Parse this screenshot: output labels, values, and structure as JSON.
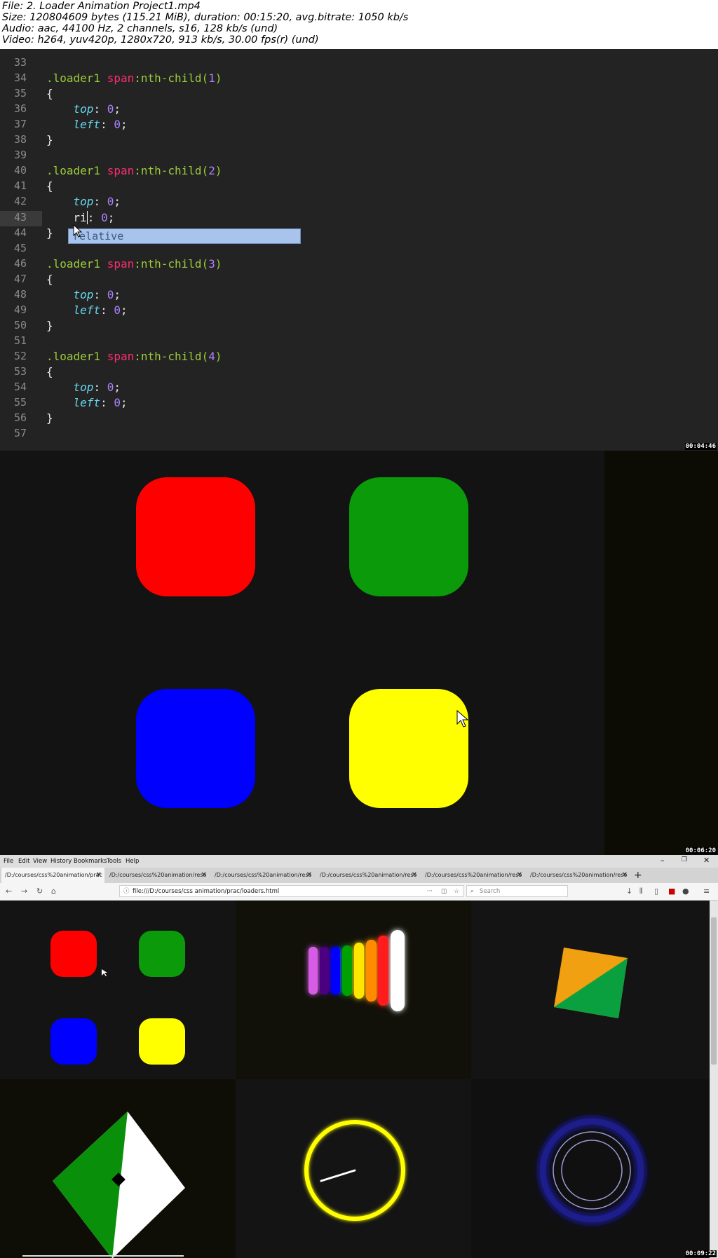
{
  "info": {
    "file": "File: 2. Loader Animation Project1.mp4",
    "size": "Size: 120804609 bytes (115.21 MiB), duration: 00:15:20, avg.bitrate: 1050 kb/s",
    "audio": "Audio: aac, 44100 Hz, 2 channels, s16, 128 kb/s (und)",
    "video": "Video: h264, yuv420p, 1280x720, 913 kb/s, 30.00 fps(r) (und)"
  },
  "timestamps": [
    "00:04:46",
    "00:06:20",
    "00:09:22"
  ],
  "editor": {
    "lines": [
      {
        "n": "33"
      },
      {
        "n": "34",
        "sel": ".loader1 ",
        "tag": "span",
        "sel2": ":nth-child(",
        "num": "1",
        "end": ")"
      },
      {
        "n": "35",
        "text": "{"
      },
      {
        "n": "36",
        "prop": "top",
        "num": "0"
      },
      {
        "n": "37",
        "prop": "left",
        "num": "0"
      },
      {
        "n": "38",
        "text": "}"
      },
      {
        "n": "39"
      },
      {
        "n": "40",
        "sel": ".loader1 ",
        "tag": "span",
        "sel2": ":nth-child(",
        "num": "2",
        "end": ")"
      },
      {
        "n": "41",
        "text": "{"
      },
      {
        "n": "42",
        "prop": "top",
        "num": "0"
      },
      {
        "n": "43",
        "typed": "ri",
        "num": "0"
      },
      {
        "n": "44",
        "text": "}"
      },
      {
        "n": "45"
      },
      {
        "n": "46",
        "sel": ".loader1 ",
        "tag": "span",
        "sel2": ":nth-child(",
        "num": "3",
        "end": ")"
      },
      {
        "n": "47",
        "text": "{"
      },
      {
        "n": "48",
        "prop": "top",
        "num": "0"
      },
      {
        "n": "49",
        "prop": "left",
        "num": "0"
      },
      {
        "n": "50",
        "text": "}"
      },
      {
        "n": "51"
      },
      {
        "n": "52",
        "sel": ".loader1 ",
        "tag": "span",
        "sel2": ":nth-child(",
        "num": "4",
        "end": ")"
      },
      {
        "n": "53",
        "text": "{"
      },
      {
        "n": "54",
        "prop": "top",
        "num": "0"
      },
      {
        "n": "55",
        "prop": "left",
        "num": "0"
      },
      {
        "n": "56",
        "text": "}"
      },
      {
        "n": "57"
      }
    ],
    "autocomplete": "relative"
  },
  "colors": {
    "red": "#ff0000",
    "green": "#0a9a0a",
    "blue": "#0000ff",
    "yellow": "#ffff00"
  },
  "browser": {
    "menu": [
      "File",
      "Edit",
      "View",
      "History",
      "Bookmarks",
      "Tools",
      "Help"
    ],
    "tabs": [
      "/D:/courses/css%20animation/prac",
      "/D:/courses/css%20animation/reso",
      "/D:/courses/css%20animation/reso",
      "/D:/courses/css%20animation/reso",
      "/D:/courses/css%20animation/reso",
      "/D:/courses/css%20animation/reso"
    ],
    "url": "file:///D:/courses/css animation/prac/loaders.html",
    "search_placeholder": "Search"
  }
}
